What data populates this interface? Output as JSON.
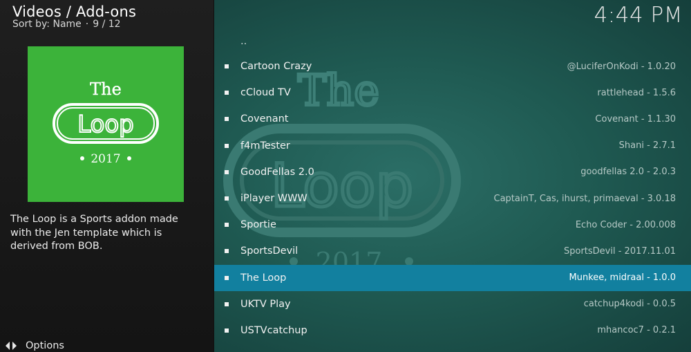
{
  "header": {
    "title": "Videos / Add-ons",
    "sort_label": "Sort by: Name",
    "separator": "·",
    "position": "9 / 12"
  },
  "clock": "4:44 PM",
  "thumbnail": {
    "logo_top": "The",
    "logo_main": "Loop",
    "logo_year": "2017",
    "background_color": "#3cb33a"
  },
  "description": "The Loop is a Sports addon made with the Jen template which is derived from BOB.",
  "options": {
    "label": "Options",
    "icon": "options-arrows-icon"
  },
  "list": {
    "parent_label": "..",
    "selected_index": 8,
    "items": [
      {
        "name": "Cartoon Crazy",
        "meta": "@LuciferOnKodi - 1.0.20"
      },
      {
        "name": "cCloud TV",
        "meta": "rattlehead - 1.5.6"
      },
      {
        "name": "Covenant",
        "meta": "Covenant - 1.1.30"
      },
      {
        "name": "f4mTester",
        "meta": "Shani - 2.7.1"
      },
      {
        "name": "GoodFellas 2.0",
        "meta": "goodfellas 2.0 - 2.0.3"
      },
      {
        "name": "iPlayer WWW",
        "meta": "CaptainT, Cas, ihurst, primaeval - 3.0.18"
      },
      {
        "name": "Sportie",
        "meta": "Echo Coder - 2.00.008"
      },
      {
        "name": "SportsDevil",
        "meta": "SportsDevil - 2017.11.01"
      },
      {
        "name": "The Loop",
        "meta": "Munkee, midraal - 1.0.0"
      },
      {
        "name": "UKTV Play",
        "meta": "catchup4kodi - 0.0.5"
      },
      {
        "name": "USTVcatchup",
        "meta": "mhancoc7 - 0.2.1"
      }
    ]
  },
  "colors": {
    "selection": "#12809f",
    "right_panel": "#1f5a52",
    "left_panel": "#1a1a1a"
  }
}
